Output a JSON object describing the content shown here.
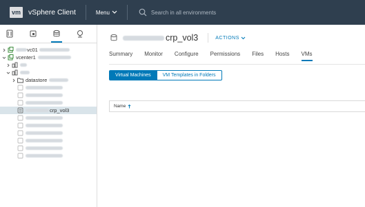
{
  "header": {
    "logo": "vm",
    "app_title": "vSphere Client",
    "menu_label": "Menu",
    "search_placeholder": "Search in all environments"
  },
  "left_panel": {
    "view_icons": [
      "hosts-clusters-icon",
      "vms-templates-icon",
      "storage-icon",
      "networking-icon"
    ],
    "tree": {
      "vc01_suffix": "vc01",
      "vcenter1_label": "vcenter1",
      "datastore_label": "datastore",
      "selected_suffix": "crp_vol3"
    }
  },
  "main": {
    "title": "crp_vol3",
    "actions_label": "ACTIONS",
    "tabs": [
      "Summary",
      "Monitor",
      "Configure",
      "Permissions",
      "Files",
      "Hosts",
      "VMs"
    ],
    "active_tab": "VMs",
    "segments": [
      "Virtual Machines",
      "VM Templates in Folders"
    ],
    "grid_column": "Name"
  },
  "colors": {
    "header_bg": "#2f3f4f",
    "accent": "#0079b8",
    "selected_row": "#d9e4ea"
  }
}
